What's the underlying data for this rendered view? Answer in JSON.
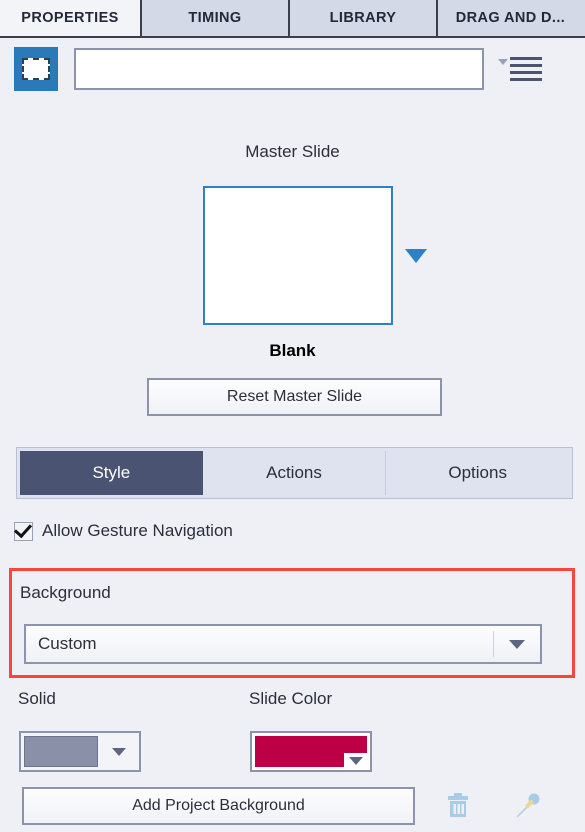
{
  "tabs": [
    {
      "label": "PROPERTIES",
      "active": true
    },
    {
      "label": "TIMING",
      "active": false
    },
    {
      "label": "LIBRARY",
      "active": false
    },
    {
      "label": "DRAG AND D...",
      "active": false
    }
  ],
  "name_row": {
    "slide_icon": "slide-thumbnail-icon",
    "name_value": "",
    "name_placeholder": "",
    "menu_icon": "hamburger-menu-icon"
  },
  "master_slide": {
    "label": "Master Slide",
    "thumbnail_color": "#ffffff",
    "thumbnail_border": "#2f80c4",
    "dropdown_icon": "chevron-down-icon",
    "name": "Blank",
    "reset_label": "Reset Master Slide"
  },
  "segments": [
    {
      "label": "Style",
      "active": true
    },
    {
      "label": "Actions",
      "active": false
    },
    {
      "label": "Options",
      "active": false
    }
  ],
  "gesture": {
    "label": "Allow Gesture Navigation",
    "checked": true
  },
  "background": {
    "section_label": "Background",
    "selected": "Custom",
    "options": [
      "Custom"
    ],
    "highlight_color": "#f8463c"
  },
  "colors_row": {
    "solid_label": "Solid",
    "solid_color": "#8a90a8",
    "slide_color_label": "Slide Color",
    "slide_color": "#bd0045"
  },
  "footer": {
    "add_background_label": "Add Project Background",
    "trash_icon": "trash-icon",
    "pencil_icon": "eyedropper-pencil-icon",
    "icon_color": "#a8cbe8"
  }
}
